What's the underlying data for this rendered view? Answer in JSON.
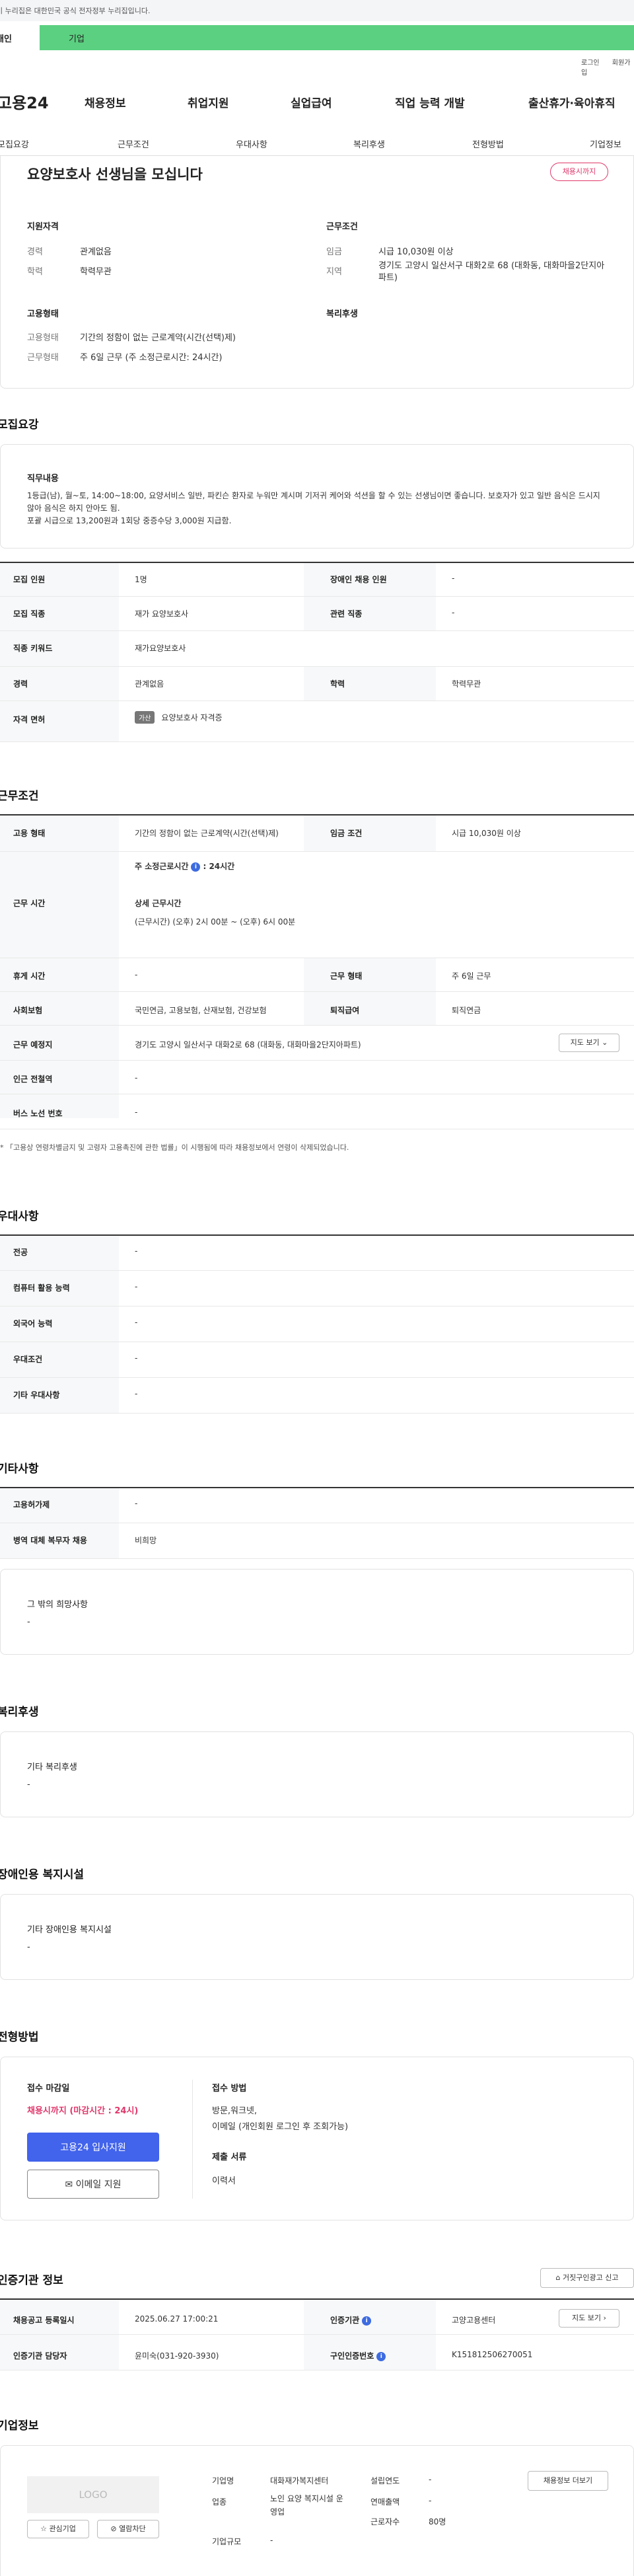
{
  "topbar": {
    "notice": "이 누리집은 대한민국 공식 전자정부 누리집입니다."
  },
  "user_tabs": {
    "personal": "개인",
    "company": "기업"
  },
  "util": {
    "login": "로그인",
    "signup": "회원가입"
  },
  "gnb": {
    "logo": "고용24",
    "items": [
      "채용정보",
      "취업지원",
      "실업급여",
      "직업 능력 개발",
      "출산휴가·육아휴직"
    ]
  },
  "subtabs": [
    "모집요강",
    "근무조건",
    "우대사항",
    "복리후생",
    "전형방법",
    "기업정보"
  ],
  "summary": {
    "title": "요양보호사 선생님을 모십니다",
    "badge": "채용시까지",
    "qual_title": "지원자격",
    "career_label": "경력",
    "career_value": "관계없음",
    "edu_label": "학력",
    "edu_value": "학력무관",
    "cond_title": "근무조건",
    "wage_label": "임금",
    "wage_value": "시급 10,030원 이상",
    "region_label": "지역",
    "region_value": "경기도 고양시 일산서구 대화2로 68 (대화동, 대화마을2단지아파트)",
    "emp_title": "고용형태",
    "emp_type_label": "고용형태",
    "emp_type_value": "기간의 정함이 없는 근로계약(시간(선택)제)",
    "work_form_label": "근무형태",
    "work_form_value": "주 6일 근무 (주 소정근로시간: 24시간)",
    "welfare_title": "복리후생"
  },
  "recruit": {
    "title": "모집요강",
    "duty_title": "직무내용",
    "duty_text": "1등급(남), 월~토, 14:00~18:00, 요양서비스 일반, 파킨슨 환자로 누워만 계시며 기저귀 케어와 석션을 할 수 있는 선생님이면 좋습니다. 보호자가 있고 일반 음식은 드시지 않아 음식은 하지 안아도 됨.",
    "duty_text2": "포괄 시급으로  13,200원과 1회당 중증수당 3,000원 지급함.",
    "rows": [
      {
        "k1": "모집 인원",
        "v1": "1명",
        "k2": "장애인 채용 인원",
        "v2": "-"
      },
      {
        "k1": "모집 직종",
        "v1": "재가 요양보호사",
        "k2": "관련 직종",
        "v2": "-"
      },
      {
        "k1": "직종 키워드",
        "v1": "재가요양보호사"
      },
      {
        "k1": "경력",
        "v1": "관계없음",
        "k2": "학력",
        "v2": "학력무관"
      },
      {
        "k1": "자격 면허",
        "tag": "가산",
        "v1": "요양보호사 자격증"
      }
    ]
  },
  "work": {
    "title": "근무조건",
    "emp_type_k": "고용 형태",
    "emp_type_v": "기간의 정함이 없는 근로계약(시간(선택)제)",
    "wage_k": "임금 조건",
    "wage_v": "시급 10,030원 이상",
    "hours_k": "근무 시간",
    "hours_weekly_label": "주 소정근로시간",
    "hours_weekly_value": ": 24시간",
    "hours_detail_label": "상세 근무시간",
    "hours_detail_value": "(근무시간) (오후) 2시 00분 ~ (오후) 6시 00분",
    "break_k": "휴게 시간",
    "break_v": "-",
    "form_k": "근무 형태",
    "form_v": "주 6일 근무",
    "ins_k": "사회보험",
    "ins_v": "국민연금, 고용보험, 산재보험, 건강보험",
    "ret_k": "퇴직급여",
    "ret_v": "퇴직연금",
    "place_k": "근무 예정지",
    "place_v": "경기도 고양시 일산서구 대화2로 68 (대화동, 대화마을2단지아파트)",
    "map_btn": "지도 보기",
    "subway_k": "인근 전철역",
    "subway_v": "-",
    "bus_k": "버스 노선 번호",
    "bus_v": "-",
    "note": "「고용상 연령차별금지 및 고령자 고용촉진에 관한 법률」이 시행됨에 따라 채용정보에서 연령이 삭제되었습니다."
  },
  "pref": {
    "title": "우대사항",
    "rows": [
      {
        "k": "전공",
        "v": "-"
      },
      {
        "k": "컴퓨터 활용 능력",
        "v": "-"
      },
      {
        "k": "외국어 능력",
        "v": "-"
      },
      {
        "k": "우대조건",
        "v": "-"
      },
      {
        "k": "기타 우대사항",
        "v": "-"
      }
    ]
  },
  "etc": {
    "title": "기타사항",
    "rows": [
      {
        "k": "고용허가제",
        "v": "-"
      },
      {
        "k": "병역 대체 복무자 채용",
        "v": "비희망"
      }
    ],
    "other_title": "그 밖의 희망사항",
    "other_value": "-"
  },
  "welfare": {
    "title": "복리후생",
    "box_title": "기타 복리후생",
    "box_value": "-"
  },
  "disability": {
    "title": "장애인용 복지시설",
    "box_title": "기타 장애인용 복지시설",
    "box_value": "-"
  },
  "process": {
    "title": "전형방법",
    "deadline_title": "접수 마감일",
    "deadline_value": "채용시까지 (마감시간 : 24시)",
    "apply_btn": "고용24 입사지원",
    "email_btn": "이메일 지원",
    "method_title": "접수 방법",
    "method_value1": "방문,워크넷,",
    "method_value2": "이메일 (개인회원 로그인 후 조회가능)",
    "docs_title": "제출 서류",
    "docs_value": "이력서"
  },
  "agency": {
    "title": "인증기관 정보",
    "report_btn": "거짓구인광고 신고",
    "reg_k": "채용공고 등록일시",
    "reg_v": "2025.06.27 17:00:21",
    "agency_k": "인증기관",
    "agency_v": "고양고용센터",
    "map_btn": "지도 보기",
    "staff_k": "인증기관 담당자",
    "staff_v": "윤미숙(031-920-3930)",
    "num_k": "구인인증번호",
    "num_v": "K151812506270051"
  },
  "company": {
    "title": "기업정보",
    "logo": "LOGO",
    "fav_btn": "관심기업",
    "block_btn": "열람차단",
    "name_k": "기업명",
    "name_v": "대화재가복지센터",
    "year_k": "설립연도",
    "year_v": "-",
    "ind_k": "업종",
    "ind_v": "노인 요양 복지시설 운영업",
    "sales_k": "연매출액",
    "sales_v": "-",
    "size_k": "기업규모",
    "size_v": "-",
    "emp_k": "근로자수",
    "emp_v": "80명",
    "info_btn": "채용정보 더보기"
  }
}
